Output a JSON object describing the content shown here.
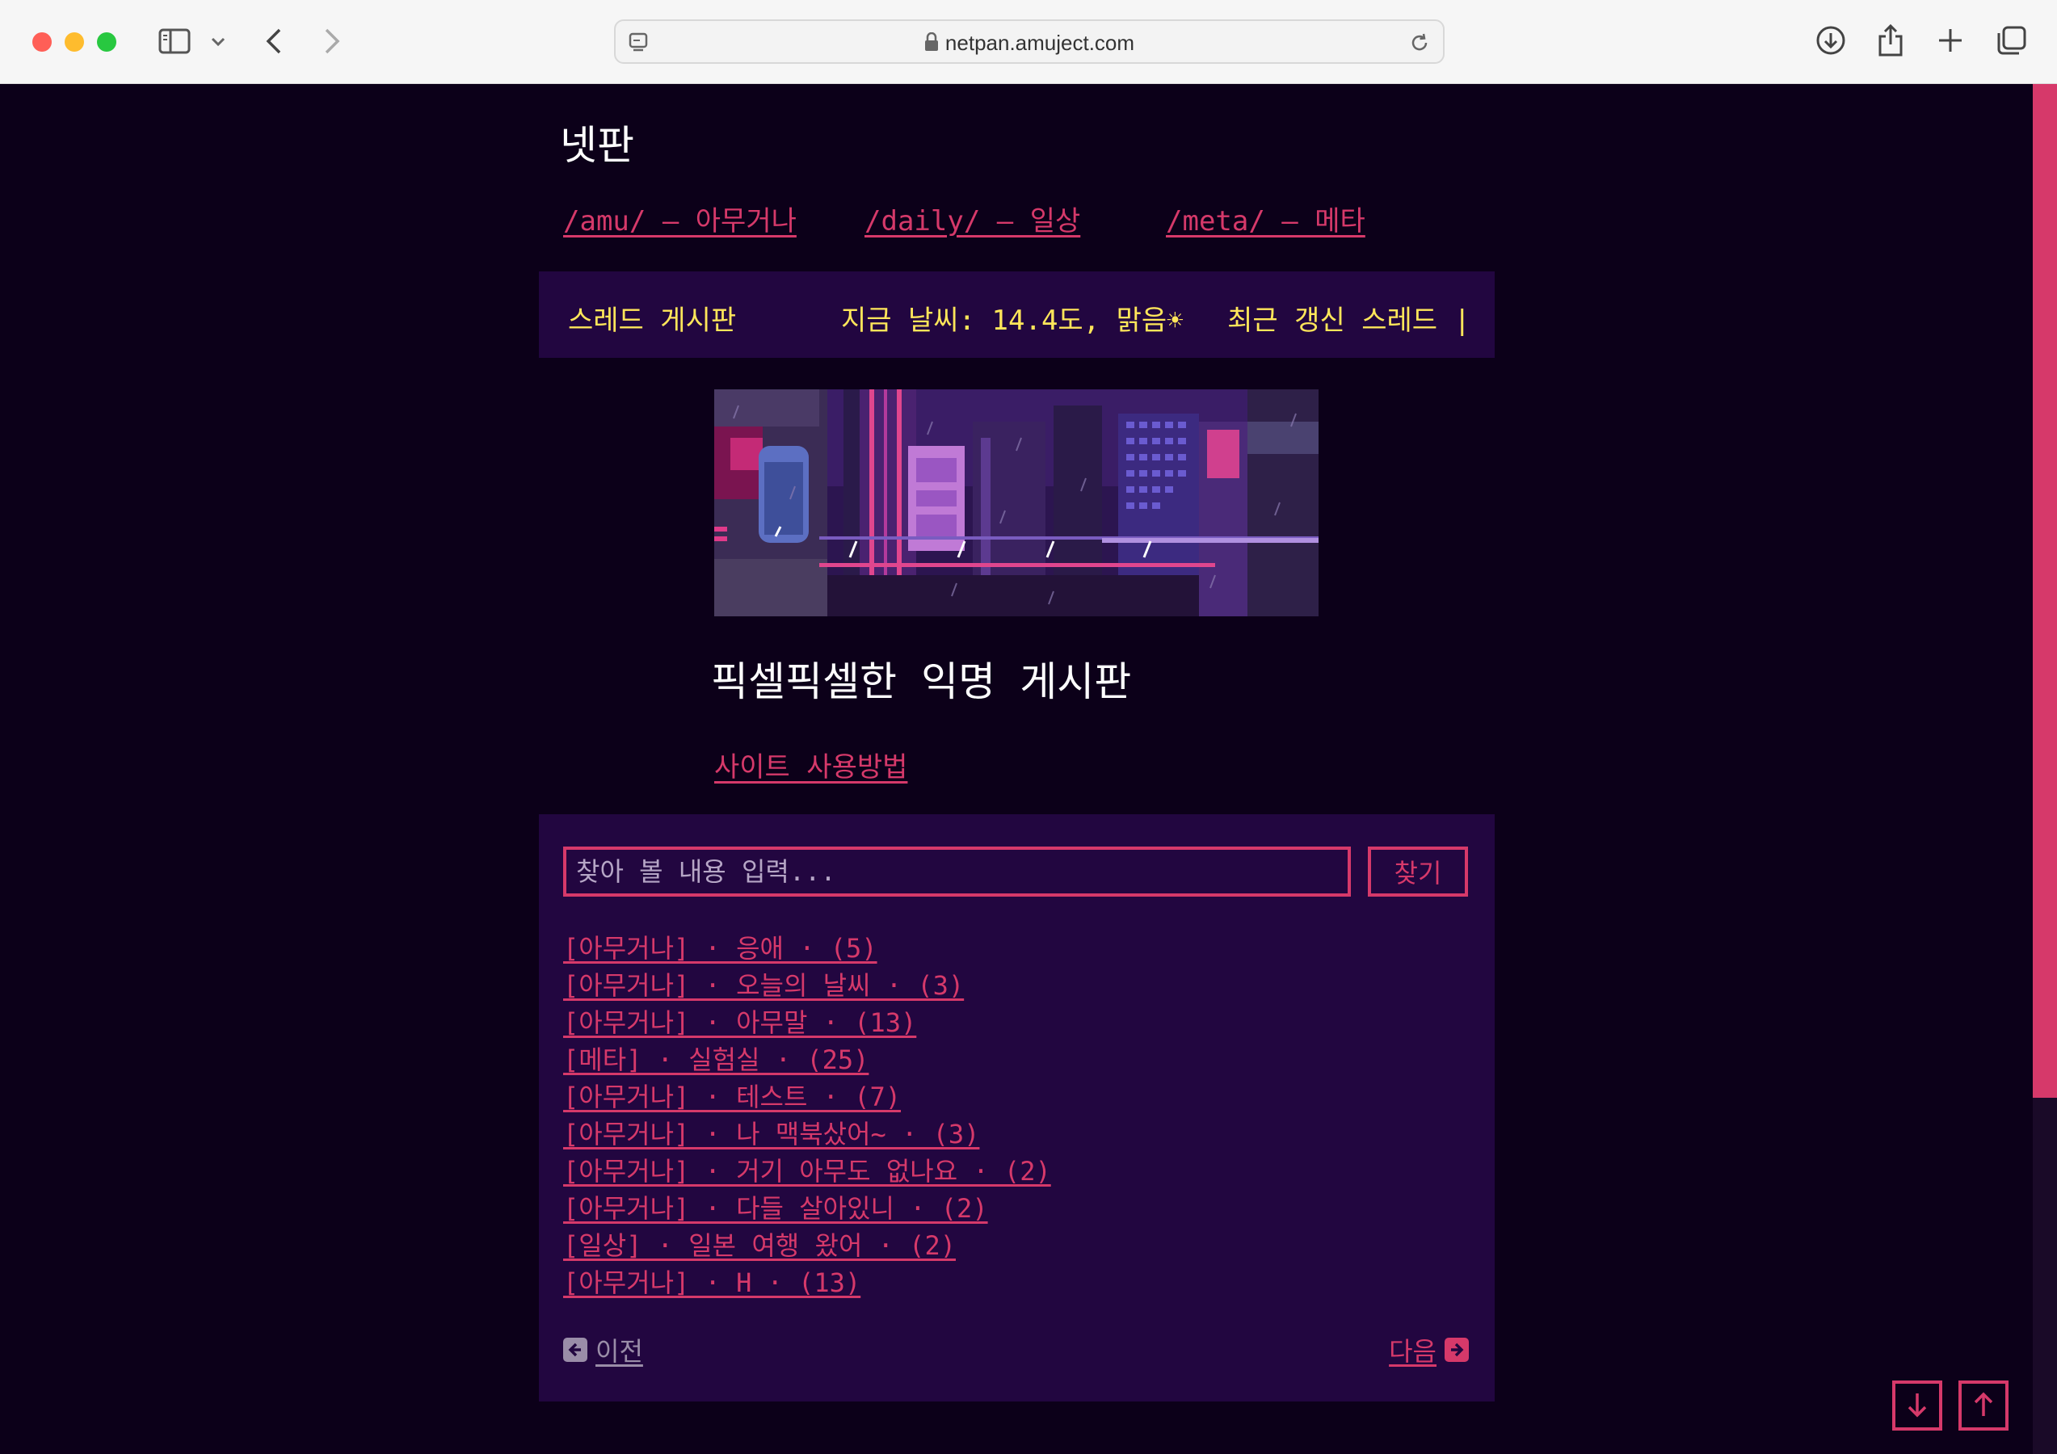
{
  "browser": {
    "url": "netpan.amuject.com"
  },
  "site": {
    "title": "넷판",
    "nav": [
      {
        "label": "/amu/ — 아무거나"
      },
      {
        "label": "/daily/ — 일상"
      },
      {
        "label": "/meta/ — 메타"
      }
    ]
  },
  "infobar": {
    "board": "스레드 게시판",
    "weather": "지금 날씨: 14.4도, 맑음☀",
    "recent": "최근 갱신 스레드 |"
  },
  "hero": {
    "title": "픽셀픽셀한 익명 게시판",
    "howto_link": "사이트 사용방법"
  },
  "search": {
    "placeholder": "찾아 볼 내용 입력...",
    "button_label": "찾기"
  },
  "threads": [
    {
      "label": "[아무거나] · 응애 · (5)"
    },
    {
      "label": "[아무거나] · 오늘의 날씨 · (3)"
    },
    {
      "label": "[아무거나] · 아무말 · (13)"
    },
    {
      "label": "[메타] · 실험실 · (25)"
    },
    {
      "label": "[아무거나] · 테스트 · (7)"
    },
    {
      "label": "[아무거나] · 나 맥북샀어~ · (3)"
    },
    {
      "label": "[아무거나] · 거기 아무도 없나요 · (2)"
    },
    {
      "label": "[아무거나] · 다들 살아있니 · (2)"
    },
    {
      "label": "[일상] · 일본 여행 왔어 · (2)"
    },
    {
      "label": "[아무거나] · H · (13)"
    }
  ],
  "pager": {
    "prev_label": "이전",
    "next_label": "다음"
  },
  "colors": {
    "background": "#0c0019",
    "panel": "#220640",
    "accent": "#d6396a",
    "highlight": "#ffe65a"
  },
  "icons": {
    "prev": "arrow-left-icon",
    "next": "arrow-right-icon",
    "scroll_down": "arrow-down-icon",
    "scroll_up": "arrow-up-icon"
  }
}
